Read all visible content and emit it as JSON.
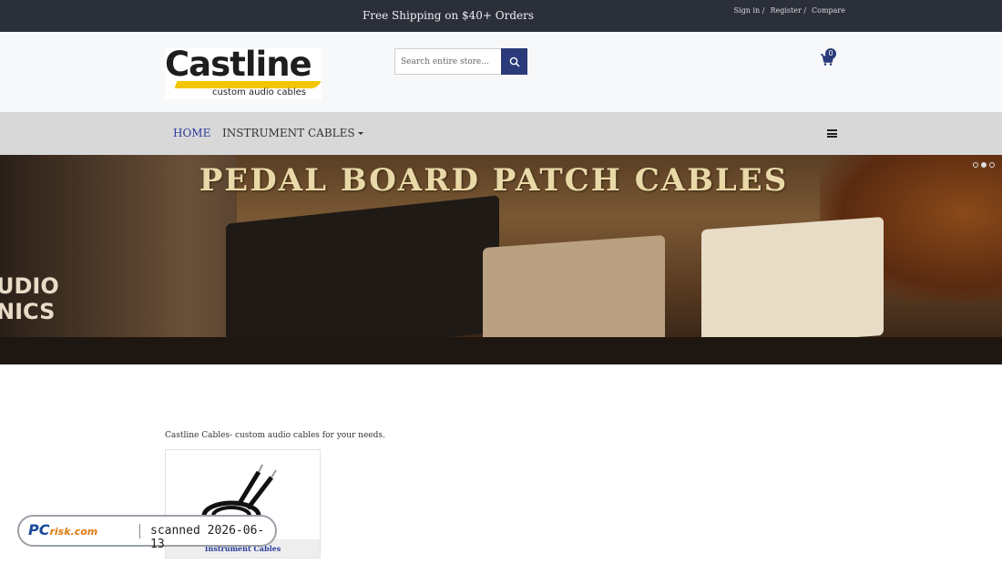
{
  "topbar": {
    "shipping": "Free Shipping on $40+ Orders",
    "links": [
      "Sign in /",
      "Register /",
      "Compare"
    ]
  },
  "header": {
    "logo": {
      "word": "Castline",
      "tagline": "custom audio cables"
    },
    "search_placeholder": "Search entire store...",
    "cart_count": "0"
  },
  "nav": {
    "home": "HOME",
    "instrument": "INSTRUMENT CABLES"
  },
  "hero": {
    "title": "PEDAL BOARD PATCH CABLES",
    "amp_text": "UDIO\nNICS",
    "slides": 3,
    "active_slide": 2
  },
  "main": {
    "intro": "Castline Cables- custom audio cables for your needs.",
    "product_caption": "Instrument Cables"
  },
  "watermark": {
    "brand": "PC",
    "brand_suffix": "risk.com",
    "stamp": "scanned 2026-06-13"
  },
  "colors": {
    "accent": "#2b3a78",
    "topbar": "#2a2f3a"
  }
}
